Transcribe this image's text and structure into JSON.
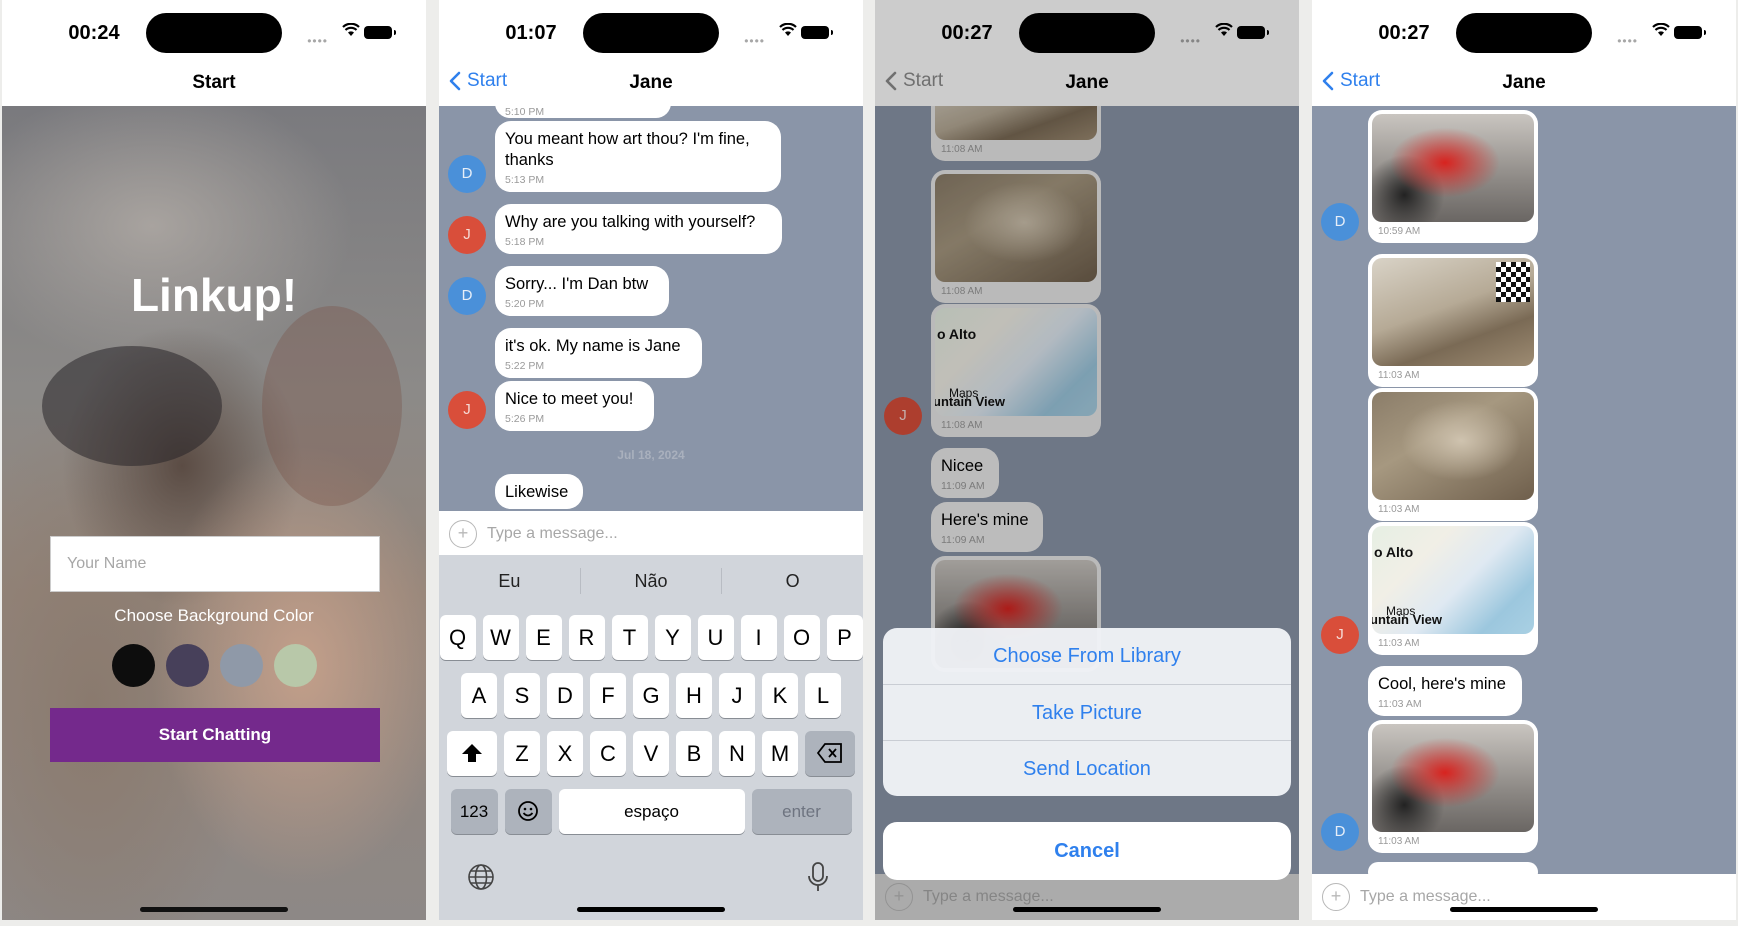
{
  "screens": {
    "start": {
      "time": "00:24",
      "nav_title": "Start",
      "app_title": "Linkup!",
      "name_placeholder": "Your Name",
      "color_label": "Choose Background Color",
      "swatch_colors": [
        "#0d0d0d",
        "#47405a",
        "#8f99a8",
        "#b8c8a9"
      ],
      "start_button": "Start Chatting",
      "start_button_color": "#74298c"
    },
    "chat_keyboard": {
      "time": "01:07",
      "back_label": "Start",
      "nav_title": "Jane",
      "chat_background": "#8a95a8",
      "partial_time": "5:10 PM",
      "messages": [
        {
          "sender": "D",
          "text": "You meant how art thou? I'm fine, thanks",
          "time": "5:13 PM"
        },
        {
          "sender": "J",
          "text": "Why are you talking with yourself?",
          "time": "5:18 PM"
        },
        {
          "sender": "D",
          "text": "Sorry... I'm Dan btw",
          "time": "5:20 PM"
        },
        {
          "sender": "J",
          "text": "it's ok. My name is Jane",
          "time": "5:22 PM"
        },
        {
          "sender": "J",
          "text": "Nice to meet you!",
          "time": "5:26 PM"
        }
      ],
      "day_separator": "Jul 18, 2024",
      "last_message": "Likewise",
      "composer_placeholder": "Type a message...",
      "suggestions": [
        "Eu",
        "Não",
        "O"
      ],
      "keyboard_rows": [
        [
          "Q",
          "W",
          "E",
          "R",
          "T",
          "Y",
          "U",
          "I",
          "O",
          "P"
        ],
        [
          "A",
          "S",
          "D",
          "F",
          "G",
          "H",
          "J",
          "K",
          "L"
        ],
        [
          "Z",
          "X",
          "C",
          "V",
          "B",
          "N",
          "M"
        ]
      ],
      "key_123": "123",
      "key_space": "espaço",
      "key_enter": "enter"
    },
    "chat_actions": {
      "time": "00:27",
      "back_label": "Start",
      "nav_title": "Jane",
      "image_times": [
        "11:08 AM",
        "11:08 AM",
        "11:08 AM"
      ],
      "map_label_top": "o Alto",
      "map_label_bottom": "untain View",
      "map_brand": "Maps",
      "avatar": "J",
      "messages": [
        {
          "text": "Nicee",
          "time": "11:09 AM"
        },
        {
          "text": "Here's mine",
          "time": "11:09 AM"
        }
      ],
      "actions": [
        "Choose From Library",
        "Take Picture",
        "Send Location"
      ],
      "cancel": "Cancel",
      "composer_placeholder": "Type a message..."
    },
    "chat_media": {
      "time": "00:27",
      "back_label": "Start",
      "nav_title": "Jane",
      "first_time": "10:59 AM",
      "image_times": [
        "11:03 AM",
        "11:03 AM",
        "11:03 AM"
      ],
      "map_label_top": "o Alto",
      "map_label_bottom": "untain View",
      "map_brand": "Maps",
      "message": {
        "text": "Cool, here's mine",
        "time": "11:03 AM"
      },
      "last_image_time": "11:03 AM",
      "avatars": [
        "D",
        "J",
        "D"
      ],
      "composer_placeholder": "Type a message..."
    }
  }
}
